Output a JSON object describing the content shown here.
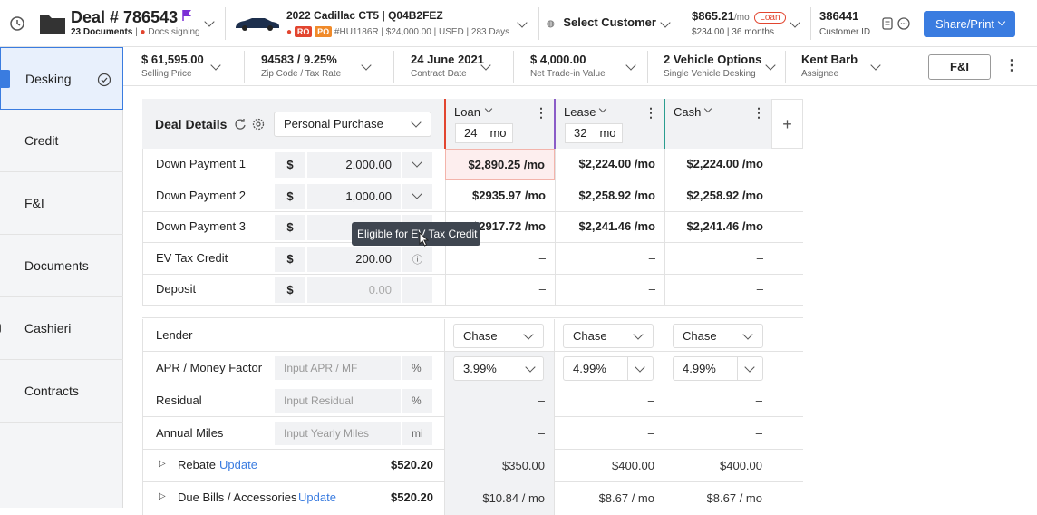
{
  "header": {
    "deal_title": "Deal # 786543",
    "documents": "23 Documents",
    "docs_status": "Docs signing",
    "vehicle_name": "2022 Cadillac CT5 | Q04B2FEZ",
    "tag_ro": "RO",
    "tag_po": "PO",
    "vehicle_info": "#HU1186R | $24,000.00 | USED | 283 Days",
    "select_customer": "Select Customer",
    "payment": "$865.21",
    "payment_unit": "/mo",
    "payment_badge": "Loan",
    "payment_sub": "$234.00 | 36 months",
    "customer_id": "386441",
    "customer_id_label": "Customer ID",
    "share_button": "Share/Print",
    "colors": {
      "accent": "#3a7ce0",
      "alert": "#e2452f",
      "flag": "#7b2fd6"
    }
  },
  "secondary": [
    {
      "value": "$ 61,595.00",
      "label": "Selling Price"
    },
    {
      "value": "94583 / 9.25%",
      "label": "Zip Code / Tax Rate"
    },
    {
      "value": "24 June 2021",
      "label": "Contract Date"
    },
    {
      "value": "$ 4,000.00",
      "label": "Net Trade-in Value"
    },
    {
      "value": "2 Vehicle Options",
      "label": "Single Vehicle Desking"
    },
    {
      "value": "Kent Barb",
      "label": "Assignee"
    }
  ],
  "fni_button": "F&I",
  "sidebar": {
    "items": [
      {
        "label": "Desking"
      },
      {
        "label": "Credit"
      },
      {
        "label": "F&I"
      },
      {
        "label": "Documents"
      },
      {
        "label": "Cashieri"
      },
      {
        "label": "Contracts"
      }
    ]
  },
  "deal": {
    "title": "Deal Details",
    "purchase_type": "Personal Purchase",
    "columns": [
      {
        "name": "Loan",
        "term": "24",
        "unit": "mo",
        "color": "#e2452f"
      },
      {
        "name": "Lease",
        "term": "32",
        "unit": "mo",
        "color": "#8a5cc7"
      },
      {
        "name": "Cash",
        "term": "",
        "unit": "",
        "color": "#2a9d8f"
      }
    ],
    "rows": [
      {
        "label": "Down Payment 1",
        "currency": "$",
        "amount": "2,000.00",
        "values": [
          "$2,890.25 /mo",
          "$2,224.00 /mo",
          "$2,224.00 /mo"
        ]
      },
      {
        "label": "Down Payment 2",
        "currency": "$",
        "amount": "1,000.00",
        "values": [
          "$2935.97 /mo",
          "$2,258.92 /mo",
          "$2,258.92 /mo"
        ]
      },
      {
        "label": "Down Payment 3",
        "currency": "$",
        "amount": "",
        "values": [
          "$2917.72 /mo",
          "$2,241.46 /mo",
          "$2,241.46 /mo"
        ]
      },
      {
        "label": "EV Tax Credit",
        "currency": "$",
        "amount": "200.00",
        "values": [
          "–",
          "–",
          "–"
        ]
      },
      {
        "label": "Deposit",
        "currency": "$",
        "amount": "0.00",
        "values": [
          "–",
          "–",
          "–"
        ]
      }
    ],
    "tooltip": "Eligible for EV Tax Credit"
  },
  "finance": {
    "lender_label": "Lender",
    "lenders": [
      "Chase",
      "Chase",
      "Chase"
    ],
    "apr_label": "APR / Money Factor",
    "apr_placeholder": "Input APR / MF",
    "apr_unit": "%",
    "apr_values": [
      "3.99%",
      "4.99%",
      "4.99%"
    ],
    "residual_label": "Residual",
    "residual_placeholder": "Input Residual",
    "residual_unit": "%",
    "residual_values": [
      "–",
      "–",
      "–"
    ],
    "miles_label": "Annual Miles",
    "miles_placeholder": "Input Yearly Miles",
    "miles_unit": "mi",
    "miles_values": [
      "–",
      "–",
      "–"
    ],
    "rebate_label": "Rebate",
    "rebate_link": "Update",
    "rebate_amount": "$520.20",
    "rebate_values": [
      "$350.00",
      "$400.00",
      "$400.00"
    ],
    "duebills_label": "Due Bills / Accessories",
    "duebills_link": "Update",
    "duebills_amount": "$520.20",
    "duebills_values": [
      "$10.84 / mo",
      "$8.67 / mo",
      "$8.67 / mo"
    ]
  }
}
